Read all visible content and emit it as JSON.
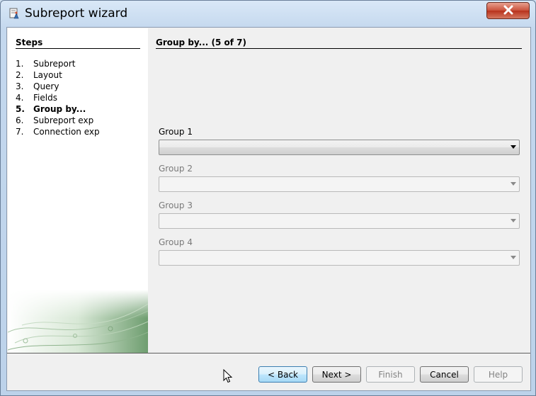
{
  "window": {
    "title": "Subreport wizard",
    "app_icon": "report-wizard-icon",
    "close_icon": "close-icon"
  },
  "steps": {
    "title": "Steps",
    "items": [
      {
        "num": "1.",
        "label": "Subreport"
      },
      {
        "num": "2.",
        "label": "Layout"
      },
      {
        "num": "3.",
        "label": "Query"
      },
      {
        "num": "4.",
        "label": "Fields"
      },
      {
        "num": "5.",
        "label": "Group by..."
      },
      {
        "num": "6.",
        "label": "Subreport exp"
      },
      {
        "num": "7.",
        "label": "Connection exp"
      }
    ],
    "current_index": 4
  },
  "main": {
    "title": "Group by... (5 of 7)",
    "groups": [
      {
        "label": "Group 1",
        "value": "",
        "enabled": true
      },
      {
        "label": "Group 2",
        "value": "",
        "enabled": false
      },
      {
        "label": "Group 3",
        "value": "",
        "enabled": false
      },
      {
        "label": "Group 4",
        "value": "",
        "enabled": false
      }
    ]
  },
  "buttons": {
    "back": "< Back",
    "next": "Next >",
    "finish": "Finish",
    "cancel": "Cancel",
    "help": "Help"
  }
}
